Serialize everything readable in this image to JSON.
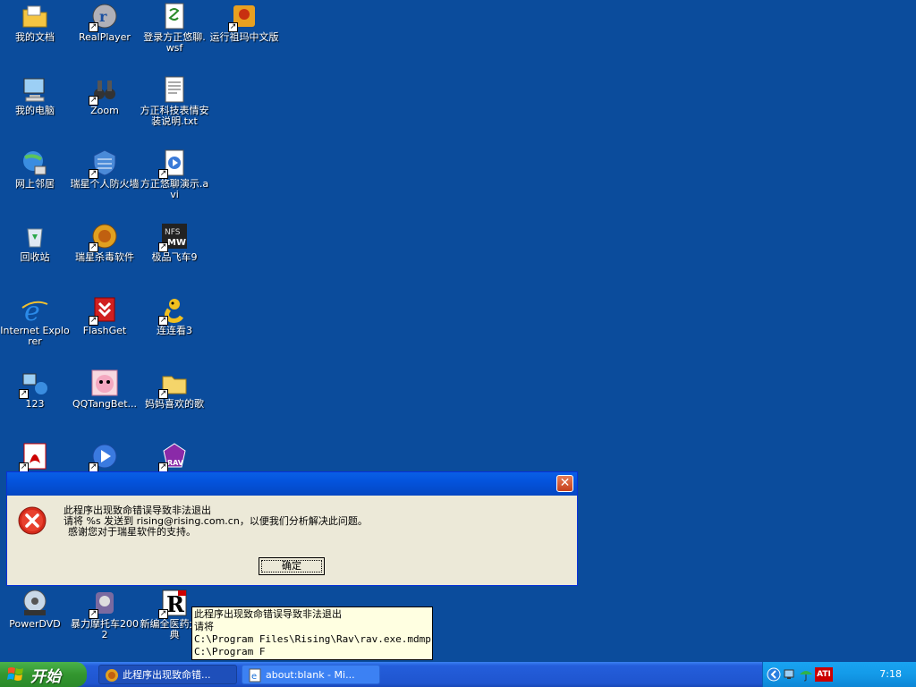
{
  "desktop": {
    "icons": [
      {
        "label": "我的文档",
        "icon": "my-documents-icon",
        "shortcut": false
      },
      {
        "label": "RealPlayer",
        "icon": "realplayer-icon",
        "shortcut": true
      },
      {
        "label": "登录方正悠聊.wsf",
        "icon": "script-file-icon",
        "shortcut": false
      },
      {
        "label": "运行祖玛中文版",
        "icon": "zuma-icon",
        "shortcut": true
      },
      {
        "label": "我的电脑",
        "icon": "my-computer-icon",
        "shortcut": false
      },
      {
        "label": "Zoom",
        "icon": "binoculars-icon",
        "shortcut": true
      },
      {
        "label": "方正科技表情安装说明.txt",
        "icon": "text-file-icon",
        "shortcut": false
      },
      {
        "label": "网上邻居",
        "icon": "network-places-icon",
        "shortcut": false
      },
      {
        "label": "瑞星个人防火墙",
        "icon": "firewall-icon",
        "shortcut": true
      },
      {
        "label": "方正悠聊演示.avi",
        "icon": "video-file-icon",
        "shortcut": true
      },
      {
        "label": "回收站",
        "icon": "recycle-bin-icon",
        "shortcut": false
      },
      {
        "label": "瑞星杀毒软件",
        "icon": "antivirus-icon",
        "shortcut": true
      },
      {
        "label": "极品飞车9",
        "icon": "nfs-game-icon",
        "shortcut": true
      },
      {
        "label": "Internet Explorer",
        "icon": "internet-explorer-icon",
        "shortcut": false
      },
      {
        "label": "FlashGet",
        "icon": "flashget-icon",
        "shortcut": true
      },
      {
        "label": "连连看3",
        "icon": "game-snake-icon",
        "shortcut": true
      },
      {
        "label": "123",
        "icon": "network-computer-icon",
        "shortcut": true
      },
      {
        "label": "QQTangBet...",
        "icon": "qqtang-icon",
        "shortcut": false
      },
      {
        "label": "妈妈喜欢的歌",
        "icon": "folder-icon",
        "shortcut": true
      },
      {
        "label": "",
        "icon": "acrobat-icon",
        "shortcut": true
      },
      {
        "label": "",
        "icon": "media-player-icon",
        "shortcut": true
      },
      {
        "label": "",
        "icon": "rav-icon",
        "shortcut": true
      },
      {
        "label": "PowerDVD",
        "icon": "powerdvd-icon",
        "shortcut": false
      },
      {
        "label": "暴力摩托车2002",
        "icon": "moto-game-icon",
        "shortcut": true
      },
      {
        "label": "新编全医药大词典",
        "icon": "dictionary-icon",
        "shortcut": true
      }
    ]
  },
  "dialog": {
    "message_line1": "此程序出现致命错误导致非法退出",
    "message_line2": "请将 %s 发送到 rising@rising.com.cn，以便我们分析解决此问题。",
    "message_line3": "感谢您对于瑞星软件的支持。",
    "ok_label": "确定"
  },
  "tooltip": {
    "lines": [
      "此程序出现致命错误导致非法退出",
      "请将",
      "C:\\Program Files\\Rising\\Rav\\rav.exe.mdmp.log",
      "C:\\Program F"
    ]
  },
  "taskbar": {
    "start_label": "开始",
    "tasks": [
      {
        "label": "此程序出现致命错...",
        "icon": "rising-lion-icon"
      },
      {
        "label": "about:blank - Mi...",
        "icon": "ie-page-icon"
      }
    ],
    "clock": "7:18",
    "tray_badge": "ATI"
  }
}
